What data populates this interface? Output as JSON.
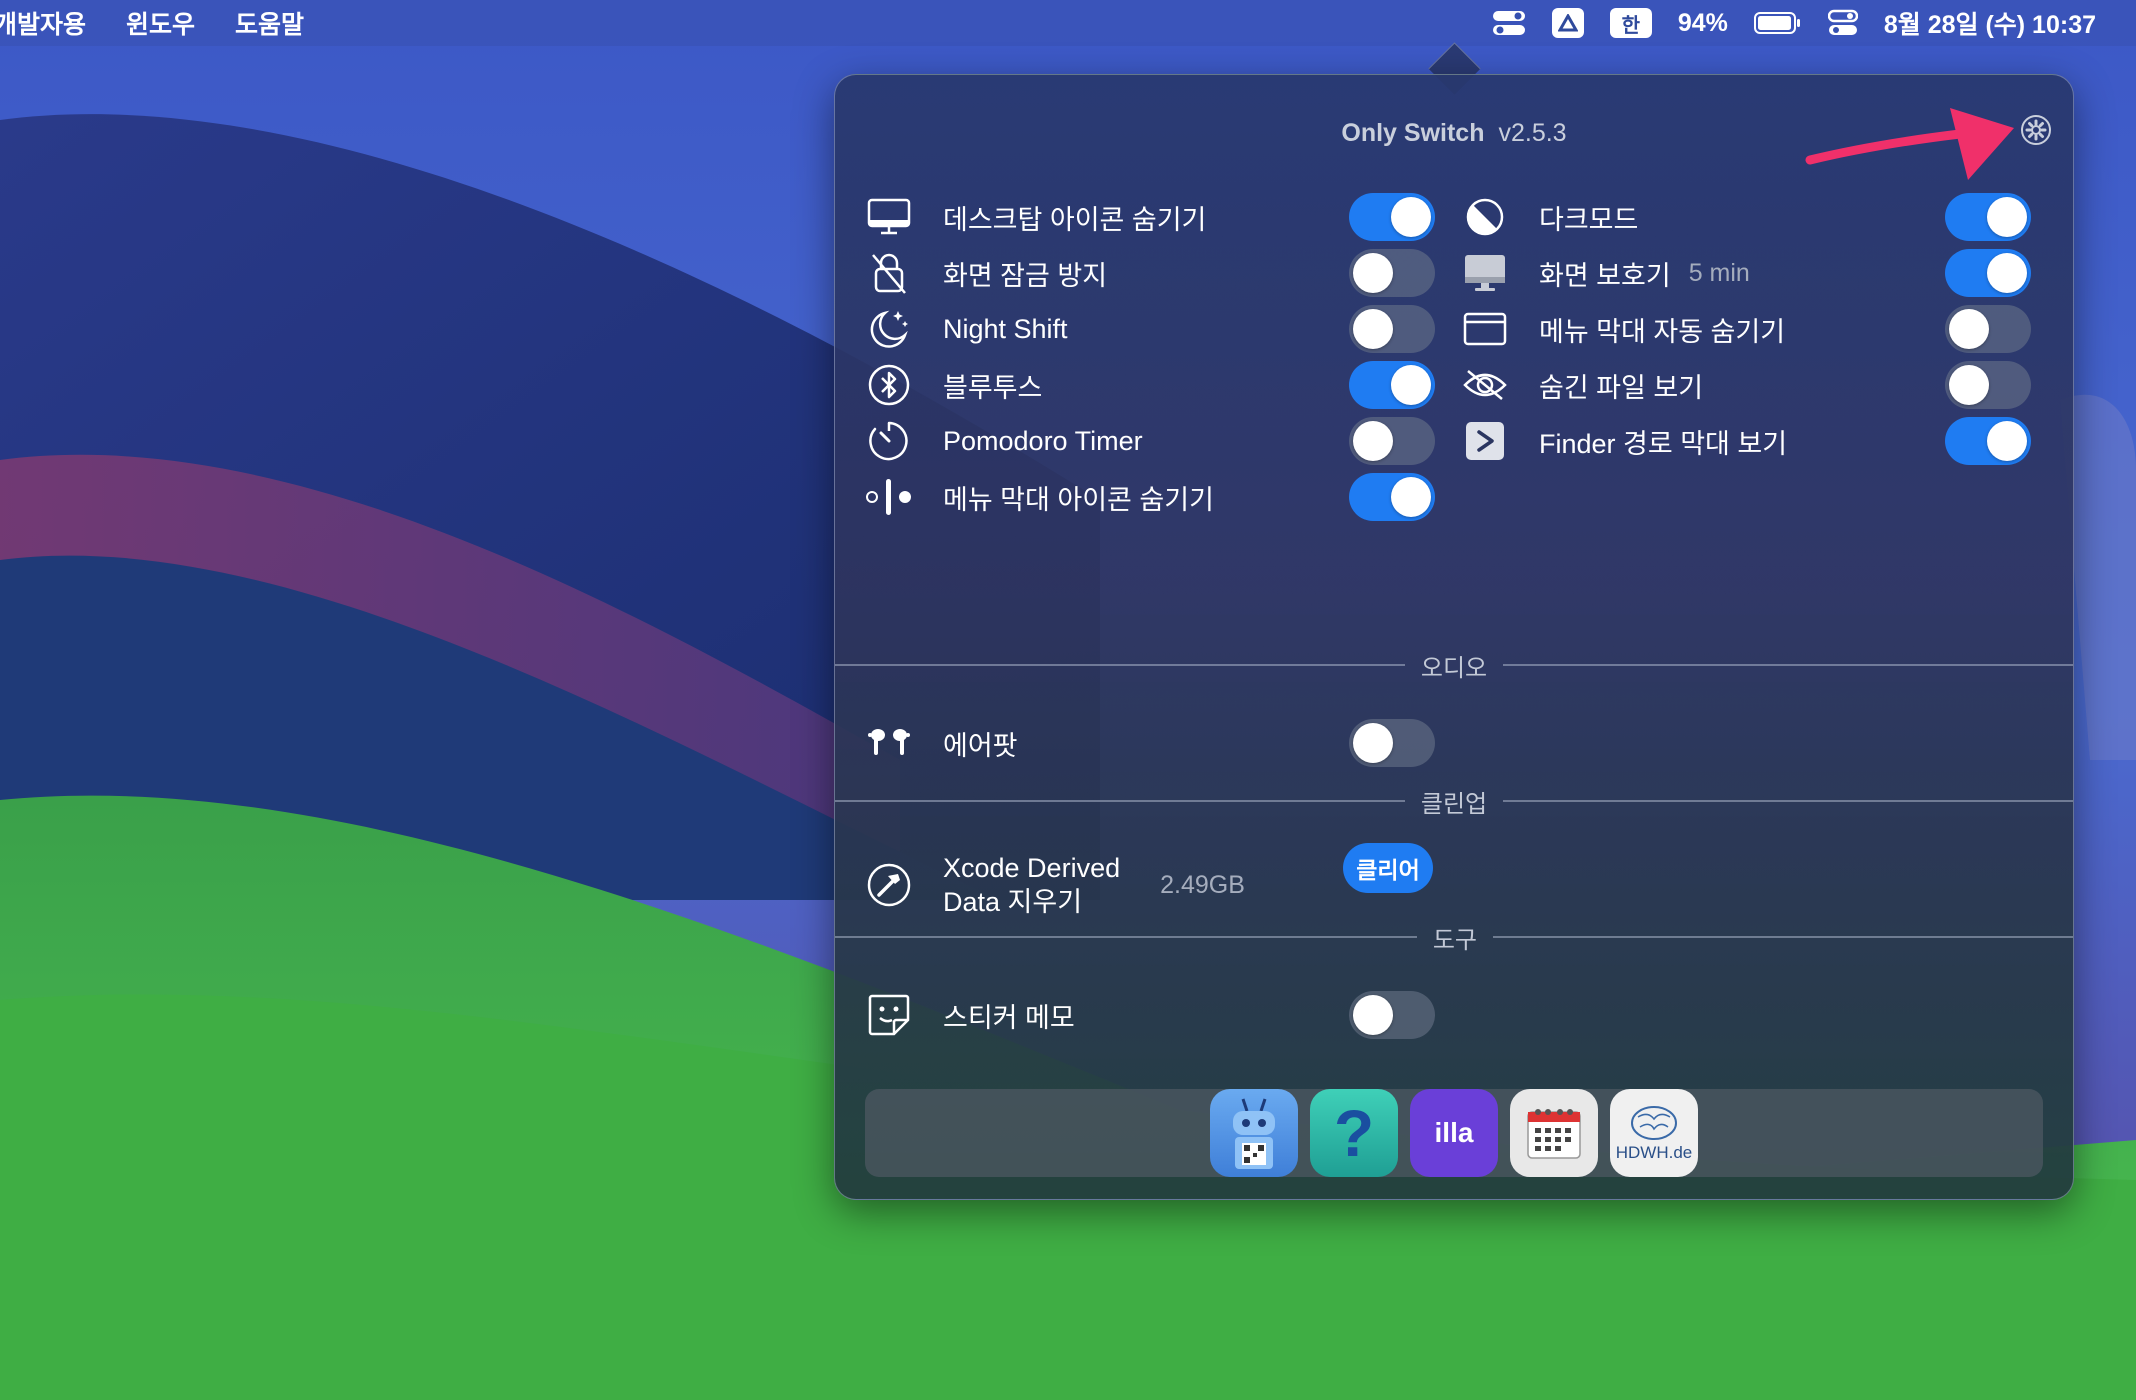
{
  "menubar": {
    "left_items": [
      "개발자용",
      "윈도우",
      "도움말"
    ],
    "input_method": "한",
    "battery_percent": "94%",
    "datetime": "8월 28일 (수) 10:37"
  },
  "panel": {
    "app_name": "Only Switch",
    "version": "v2.5.3",
    "left_switches": [
      {
        "label": "데스크탑 아이콘 숨기기",
        "icon": "desktop-icon",
        "on": true
      },
      {
        "label": "화면 잠금 방지",
        "icon": "lock-slash-icon",
        "on": false
      },
      {
        "label": "Night Shift",
        "icon": "moon-stars-icon",
        "on": false
      },
      {
        "label": "블루투스",
        "icon": "bluetooth-icon",
        "on": true
      },
      {
        "label": "Pomodoro Timer",
        "icon": "timer-icon",
        "on": false
      },
      {
        "label": "메뉴 막대 아이콘 숨기기",
        "icon": "menubar-dots-icon",
        "on": true
      }
    ],
    "right_switches": [
      {
        "label": "다크모드",
        "icon": "dark-mode-icon",
        "on": true
      },
      {
        "label": "화면 보호기",
        "sub": "5 min",
        "icon": "display-icon",
        "on": true
      },
      {
        "label": "메뉴 막대 자동 숨기기",
        "icon": "window-icon",
        "on": false
      },
      {
        "label": "숨긴 파일 보기",
        "icon": "eye-slash-icon",
        "on": false
      },
      {
        "label": "Finder 경로 막대 보기",
        "icon": "chevron-right-icon",
        "on": true
      }
    ],
    "sections": {
      "audio": "오디오",
      "cleanup": "클린업",
      "tools": "도구"
    },
    "airpods": {
      "label": "에어팟",
      "on": false
    },
    "xcode": {
      "label_line1": "Xcode Derived",
      "label_line2": "Data 지우기",
      "size": "2.49GB",
      "button": "클리어"
    },
    "sticker": {
      "label": "스티커 메모",
      "on": false
    },
    "dock_apps": [
      {
        "name": "qr-robot-app",
        "color": "#5a9be0"
      },
      {
        "name": "help-app",
        "label": "?",
        "color": "#2fb8a8"
      },
      {
        "name": "illa-app",
        "label": "illa",
        "color": "#6a3fd8"
      },
      {
        "name": "calendar-app",
        "color": "#e8e8e8"
      },
      {
        "name": "hdwh-app",
        "label": "HDWH.de",
        "color": "#f0f0f0"
      }
    ]
  },
  "colors": {
    "toggle_on": "#1f7cf2",
    "arrow": "#f0306a"
  }
}
